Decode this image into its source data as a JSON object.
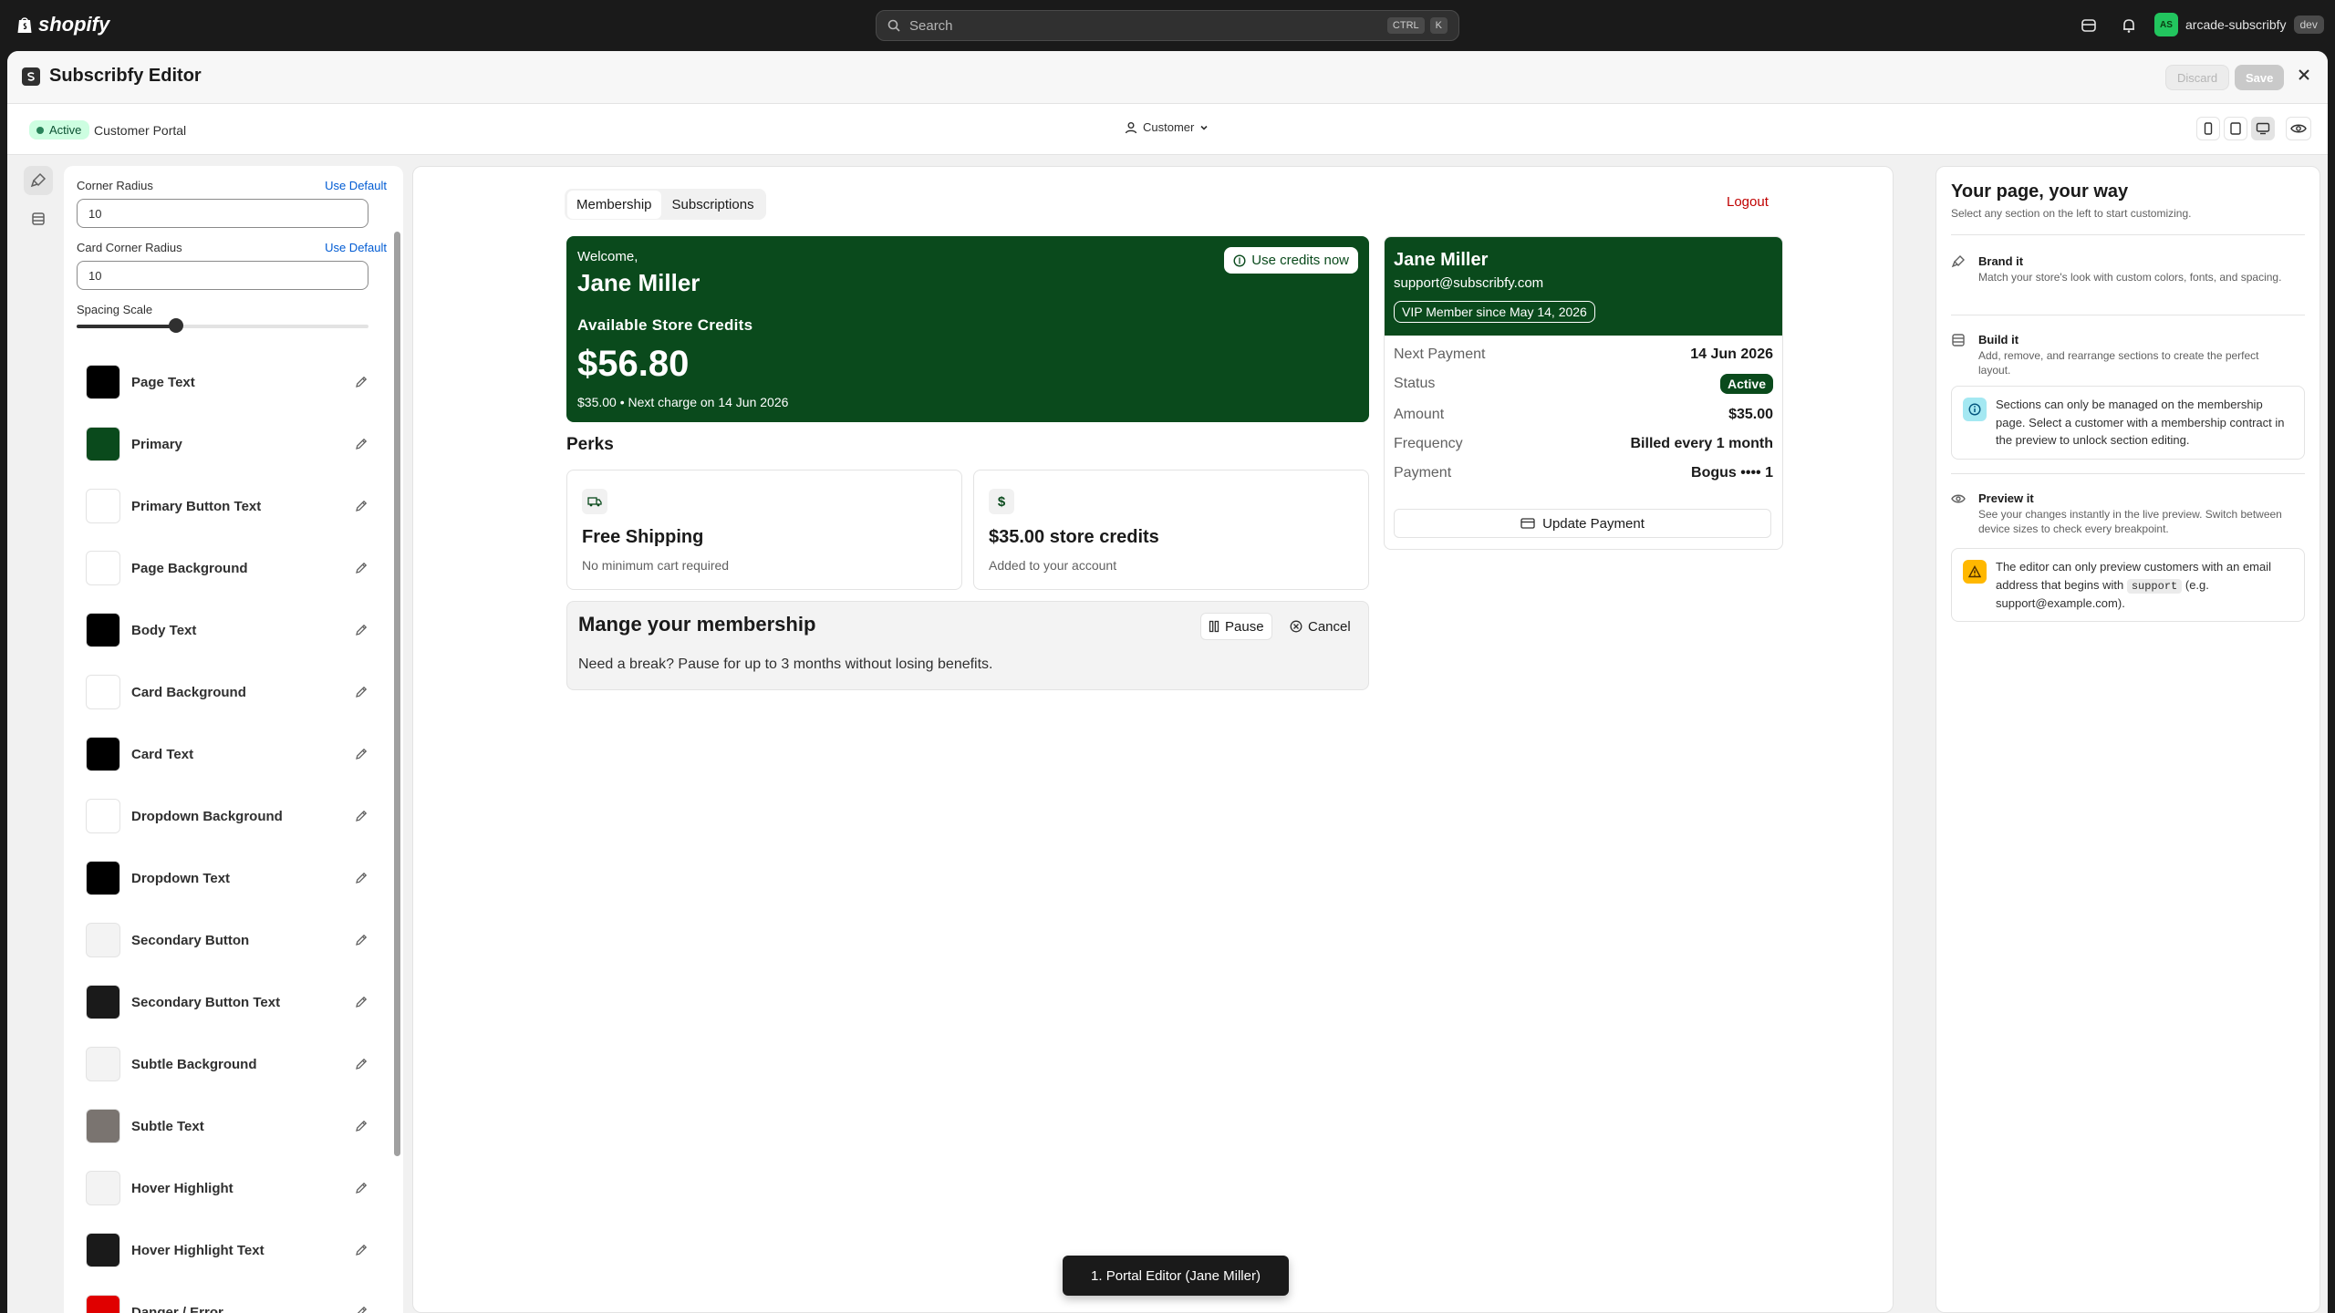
{
  "topbar": {
    "brand": "shopify",
    "search_placeholder": "Search",
    "shortcut_keys": [
      "CTRL",
      "K"
    ],
    "store_initials": "AS",
    "store_name": "arcade-subscribfy",
    "store_env": "dev"
  },
  "editor": {
    "title": "Subscribfy Editor",
    "discard_label": "Discard",
    "save_label": "Save",
    "status_badge": "Active",
    "portal_label": "Customer Portal",
    "customer_select": "Customer"
  },
  "settings": {
    "corner_radius_label": "Corner Radius",
    "corner_radius_value": "10",
    "card_corner_radius_label": "Card Corner Radius",
    "card_corner_radius_value": "10",
    "use_default_label": "Use Default",
    "spacing_scale_label": "Spacing Scale",
    "spacing_scale_fraction": 0.34,
    "colors": [
      {
        "name": "Page Text",
        "color": "#000000"
      },
      {
        "name": "Primary",
        "color": "#0a4a1c"
      },
      {
        "name": "Primary Button Text",
        "color": "#ffffff"
      },
      {
        "name": "Page Background",
        "color": "#ffffff"
      },
      {
        "name": "Body Text",
        "color": "#000000"
      },
      {
        "name": "Card Background",
        "color": "#ffffff"
      },
      {
        "name": "Card Text",
        "color": "#000000"
      },
      {
        "name": "Dropdown Background",
        "color": "#ffffff"
      },
      {
        "name": "Dropdown Text",
        "color": "#000000"
      },
      {
        "name": "Secondary Button",
        "color": "#f3f3f3"
      },
      {
        "name": "Secondary Button Text",
        "color": "#1a1a1a"
      },
      {
        "name": "Subtle Background",
        "color": "#f3f3f3"
      },
      {
        "name": "Subtle Text",
        "color": "#7a7470"
      },
      {
        "name": "Hover Highlight",
        "color": "#f3f3f3"
      },
      {
        "name": "Hover Highlight Text",
        "color": "#1a1a1a"
      },
      {
        "name": "Danger / Error",
        "color": "#e00000"
      }
    ]
  },
  "preview": {
    "tabs": [
      "Membership",
      "Subscriptions"
    ],
    "logout": "Logout",
    "welcome": "Welcome,",
    "customer_name": "Jane Miller",
    "use_credits": "Use credits now",
    "available_credits_label": "Available Store Credits",
    "credits_amount": "$56.80",
    "next_charge_line": "$35.00 • Next charge on 14 Jun 2026",
    "perks_title": "Perks",
    "perks": [
      {
        "icon": "$",
        "title": "Free Shipping",
        "subtitle": "No minimum cart required"
      },
      {
        "icon": "$",
        "title": "$35.00 store credits",
        "subtitle": "Added to your account"
      }
    ],
    "manage_title": "Mange your membership",
    "pause_label": "Pause",
    "cancel_label": "Cancel",
    "manage_desc": "Need a break? Pause for up to 3 months without losing benefits.",
    "member": {
      "name": "Jane Miller",
      "email": "support@subscribfy.com",
      "vip": "VIP Member since May 14, 2026",
      "rows": [
        {
          "key": "Next Payment",
          "value": "14 Jun 2026"
        },
        {
          "key": "Status",
          "value": "Active"
        },
        {
          "key": "Amount",
          "value": "$35.00"
        },
        {
          "key": "Frequency",
          "value": "Billed every 1 month"
        },
        {
          "key": "Payment",
          "value": "Bogus •••• 1"
        }
      ],
      "update_payment": "Update Payment"
    },
    "toast": "1. Portal Editor (Jane Miller)"
  },
  "help": {
    "title": "Your page, your way",
    "subtitle": "Select any section on the left to start customizing.",
    "steps": [
      {
        "title": "Brand it",
        "desc": "Match your store's look with custom colors, fonts, and spacing."
      },
      {
        "title": "Build it",
        "desc": "Add, remove, and rearrange sections to create the perfect layout."
      },
      {
        "title": "Preview it",
        "desc": "See your changes instantly in the live preview. Switch between device sizes to check every breakpoint."
      }
    ],
    "notice_sections": "Sections can only be managed on the membership page. Select a customer with a membership contract in the preview to unlock section editing.",
    "notice_preview_pre": "The editor can only preview customers with an email address that begins with",
    "notice_preview_code": "support",
    "notice_preview_post": "(e.g. support@example.com)."
  }
}
